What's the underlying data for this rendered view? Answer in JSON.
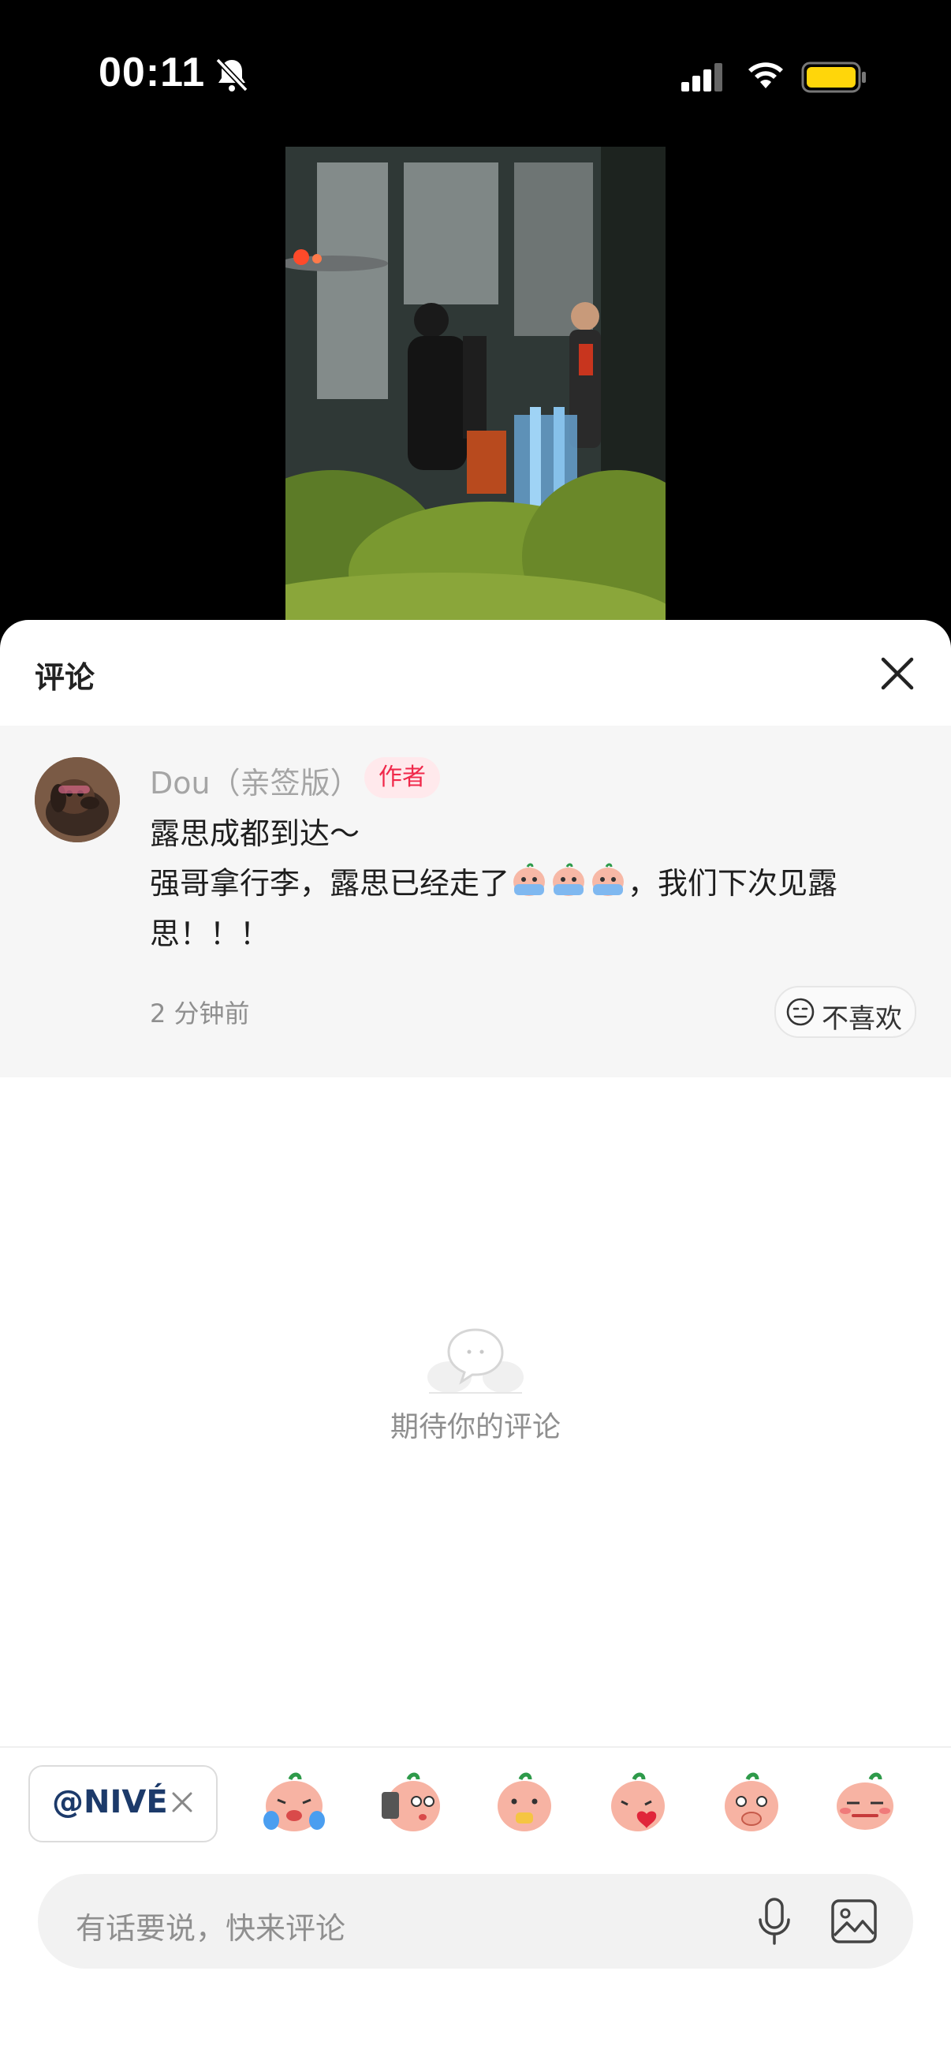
{
  "status_bar": {
    "time": "00:11",
    "icons": [
      "bell-muted-icon",
      "signal-icon",
      "wifi-icon",
      "battery-icon"
    ]
  },
  "sheet": {
    "title": "评论",
    "close_icon": "close-icon"
  },
  "comment": {
    "author": "Dou（亲签版）",
    "badge": "作者",
    "line1": "露思成都到达～",
    "text_before_emoji": "强哥拿行李，露思已经走了",
    "text_after_emoji": "，我们下次见露思！！！",
    "time_ago": "2 分钟前",
    "dislike_label": "不喜欢"
  },
  "empty_state": {
    "text": "期待你的评论"
  },
  "mention_chip": {
    "label": "@NIVÉ"
  },
  "stickers": [
    "crying-sticker",
    "phone-sticker",
    "eating-sticker",
    "heart-sticker",
    "shy-sticker",
    "sleepy-sticker"
  ],
  "input": {
    "placeholder": "有话要说，快来评论"
  },
  "colors": {
    "accent_badge": "#f0284a",
    "badge_bg": "#ffe9ec",
    "battery": "#ffd60a"
  }
}
